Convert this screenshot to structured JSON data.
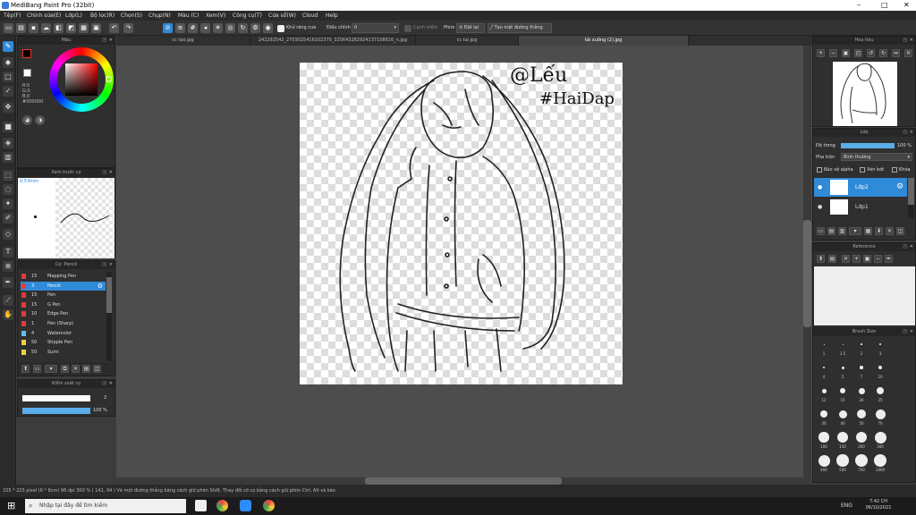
{
  "window": {
    "title": "MediBang Paint Pro (32bit)",
    "min": "–",
    "max": "□",
    "close": "✕"
  },
  "menu": [
    "Tệp(F)",
    "Chỉnh sửa(E)",
    "Lớp(L)",
    "Bộ lọc(R)",
    "Chọn(S)",
    "Chụp(N)",
    "Màu (C)",
    "Xem(V)",
    "Công cụ(T)",
    "Cửa sổ(W)",
    "Cloud",
    "Help"
  ],
  "toolbar": {
    "antialias": "Khử răng cưa",
    "correction_label": "Điều chỉnh",
    "correction_value": "0",
    "canh_mem": "Cạnh mềm",
    "phim": "Phim",
    "undo_label": "Đặt lại",
    "guideline": "Tạo mặt đường thẳng"
  },
  "tabs": [
    "cc tao.jpg",
    "242292542_2703025416102370_325643282924137108616_n.jpg",
    "cc tai.jpg",
    "tải xuống (2).jpg"
  ],
  "color_panel": {
    "title": "Màu",
    "r": "R:0",
    "g": "G:0",
    "b": "B:0",
    "hex": "#000000"
  },
  "preview_panel": {
    "title": "Xem trước cọ",
    "size": "0.53mm"
  },
  "brush_panel": {
    "title": "Cọ: Pencil",
    "brushes": [
      {
        "size": "15",
        "name": "Mapping Pen",
        "color": "#e23b3b"
      },
      {
        "size": "3",
        "name": "Pencil",
        "color": "#e23b3b"
      },
      {
        "size": "15",
        "name": "Pen",
        "color": "#e23b3b"
      },
      {
        "size": "15",
        "name": "G Pen",
        "color": "#e23b3b"
      },
      {
        "size": "10",
        "name": "Edge Pen",
        "color": "#e23b3b"
      },
      {
        "size": "1",
        "name": "Pen (Sharp)",
        "color": "#e23b3b"
      },
      {
        "size": "4",
        "name": "Watercolor",
        "color": "#5bc0f0"
      },
      {
        "size": "50",
        "name": "Stipple Pen",
        "color": "#f0d040"
      },
      {
        "size": "50",
        "name": "Sumi",
        "color": "#f0d040"
      }
    ]
  },
  "brush_control": {
    "title": "Kiểm soát cọ",
    "size": "2",
    "opacity": "100 %"
  },
  "navigator": {
    "title": "Hoa tiêu"
  },
  "layer_panel": {
    "title": "Lớp",
    "opacity_label": "Độ trong",
    "opacity": "100 %",
    "blend_label": "Pha trộn",
    "blend": "Bình thường",
    "alpha": "Bảo vệ alpha",
    "clip": "Xén bớt",
    "lock": "Khóa",
    "layers": [
      "Lớp2",
      "Lớp1"
    ]
  },
  "reference": {
    "title": "Reference"
  },
  "brush_size": {
    "title": "Brush Size",
    "sizes": [
      "1",
      "1.5",
      "2",
      "3",
      "4",
      "5",
      "7",
      "10",
      "12",
      "15",
      "20",
      "25",
      "30",
      "40",
      "50",
      "70",
      "100",
      "150",
      "200",
      "300",
      "400",
      "500",
      "700",
      "1000"
    ]
  },
  "status": "225 * 225 pixel  (6 * 6cm)  96 dpi  300 %  ( 141, 94 )  Vẽ một đường thẳng bằng cách giữ phím Shift, Thay đổi cỡ cọ bằng cách giữ phím Ctrl, Alt và kéo",
  "taskbar": {
    "search": "Nhập tại đây để tìm kiếm",
    "lang": "ENG",
    "time": "7:42 CH",
    "date": "06/10/2021"
  },
  "artwork": {
    "handle": "@Lếu",
    "tag": "#HaiDap"
  }
}
